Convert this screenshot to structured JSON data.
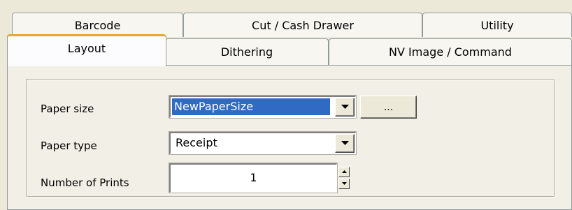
{
  "tabs_back": [
    {
      "label": "Barcode"
    },
    {
      "label": "Cut / Cash Drawer"
    },
    {
      "label": "Utility"
    }
  ],
  "tabs_front": [
    {
      "label": "Layout",
      "selected": true
    },
    {
      "label": "Dithering",
      "selected": false
    },
    {
      "label": "NV Image / Command",
      "selected": false
    }
  ],
  "form": {
    "paper_size_label": "Paper size",
    "paper_size_value": "NewPaperSize",
    "browse_button_label": "...",
    "paper_type_label": "Paper type",
    "paper_type_value": "Receipt",
    "number_of_prints_label": "Number of Prints",
    "number_of_prints_value": "1"
  },
  "colors": {
    "selected_tab_accent": "#e8a72c",
    "selection_highlight": "#316ac5",
    "dialog_background": "#ece9d8"
  },
  "icons": {
    "dropdown": "chevron-down-icon",
    "spin_up": "spin-up-icon",
    "spin_down": "spin-down-icon"
  }
}
